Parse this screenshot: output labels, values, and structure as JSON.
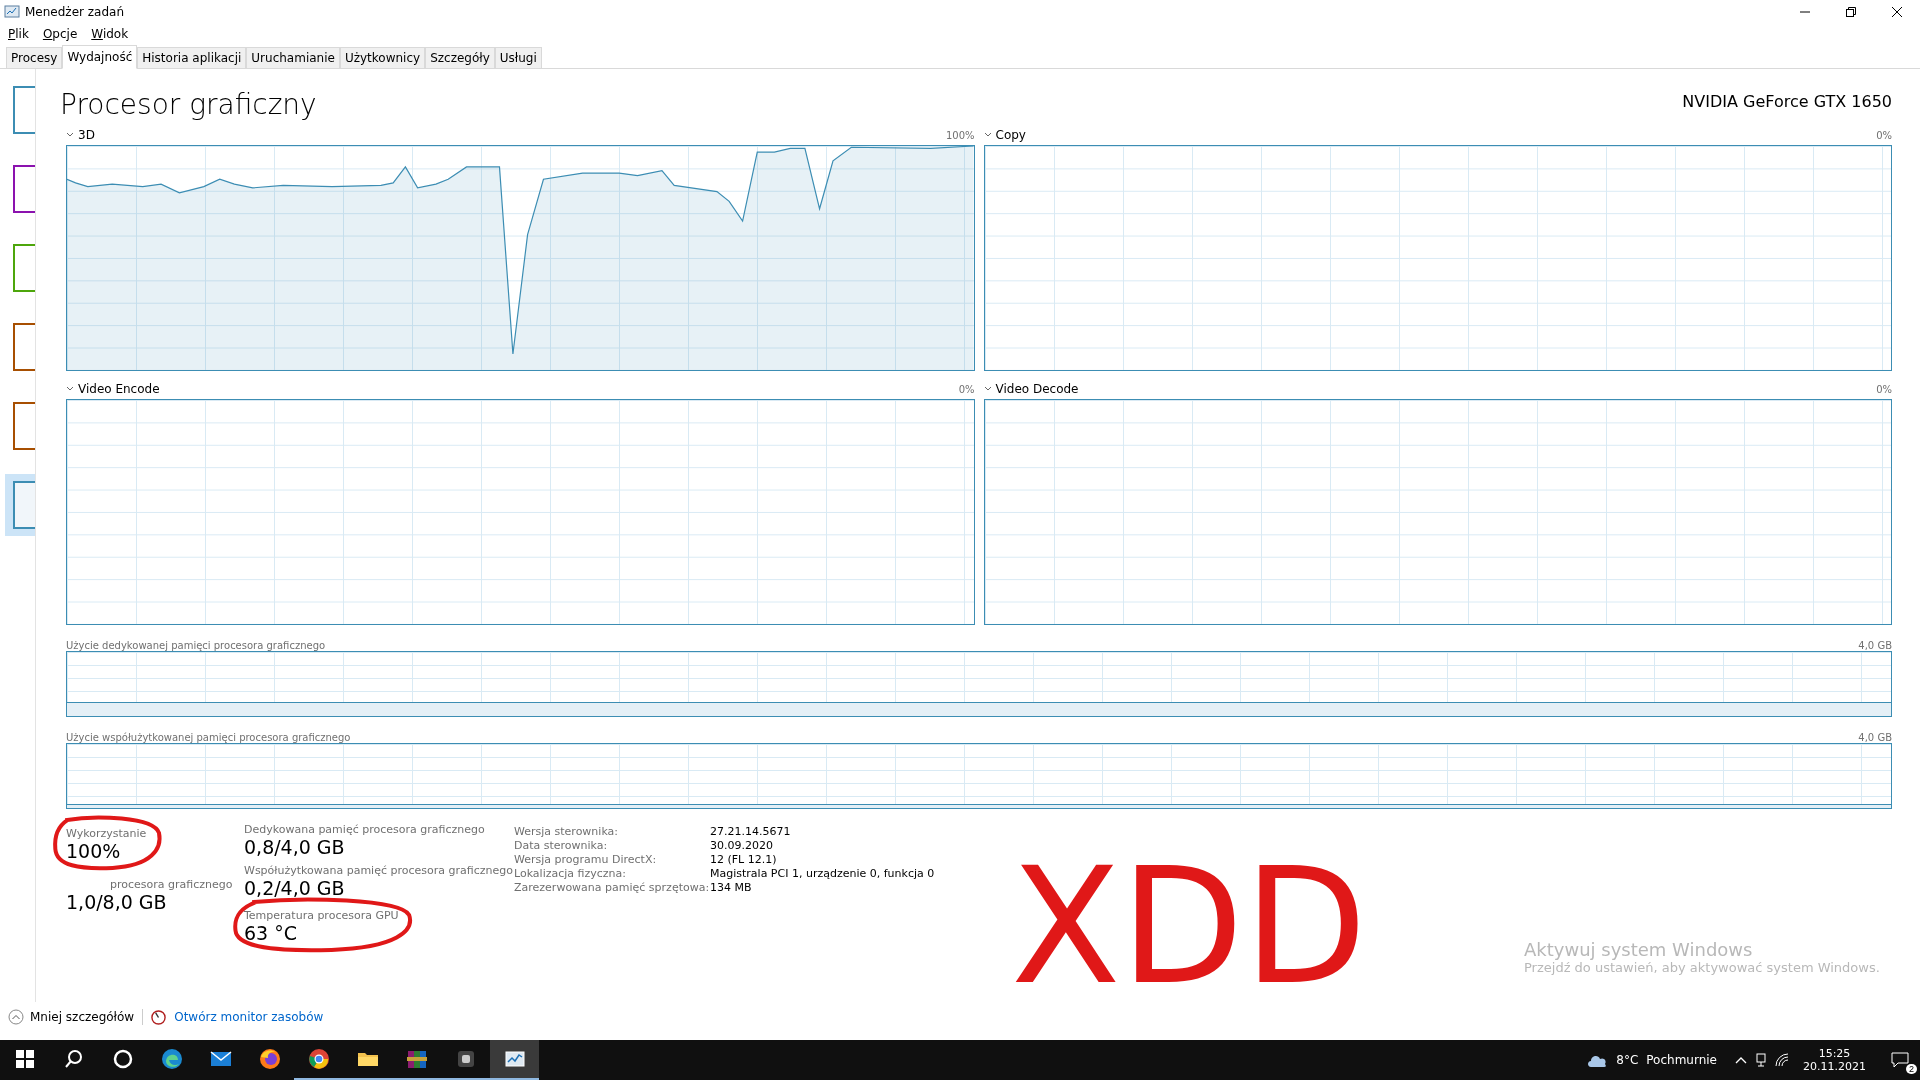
{
  "window": {
    "title": "Menedżer zadań"
  },
  "menu": [
    "Plik",
    "Opcje",
    "Widok"
  ],
  "tabs": [
    {
      "label": "Procesy",
      "selected": false
    },
    {
      "label": "Wydajność",
      "selected": true
    },
    {
      "label": "Historia aplikacji",
      "selected": false
    },
    {
      "label": "Uruchamianie",
      "selected": false
    },
    {
      "label": "Użytkownicy",
      "selected": false
    },
    {
      "label": "Szczegóły",
      "selected": false
    },
    {
      "label": "Usługi",
      "selected": false
    }
  ],
  "sidebar": {
    "items": [
      {
        "color": "#3c8db3",
        "selected": false
      },
      {
        "color": "#8b12ae",
        "selected": false
      },
      {
        "color": "#4da60c",
        "selected": false
      },
      {
        "color": "#a74f01",
        "selected": false
      },
      {
        "color": "#a74f01",
        "selected": false
      },
      {
        "color": "#3c8db3",
        "selected": true
      }
    ]
  },
  "header": {
    "title": "Procesor graficzny",
    "device": "NVIDIA GeForce GTX 1650"
  },
  "engines": [
    {
      "label": "3D",
      "max": "100%",
      "kind": "busy"
    },
    {
      "label": "Copy",
      "max": "0%",
      "kind": "idle"
    },
    {
      "label": "Video Encode",
      "max": "0%",
      "kind": "idle"
    },
    {
      "label": "Video Decode",
      "max": "0%",
      "kind": "idle"
    }
  ],
  "memory_graphs": [
    {
      "label": "Użycie dedykowanej pamięci procesora graficznego",
      "max": "4,0 GB"
    },
    {
      "label": "Użycie współużytkowanej pamięci procesora graficznego",
      "max": "4,0 GB"
    }
  ],
  "stats_columns": [
    [
      {
        "label": "Wykorzystanie",
        "value": "100%",
        "circled": true
      },
      {
        "label": "procesora graficznego",
        "value": "1,0/8,0 GB"
      }
    ],
    [
      {
        "label": "Dedykowana pamięć procesora graficznego",
        "value": "0,8/4,0 GB"
      },
      {
        "label": "Współużytkowana pamięć procesora graficznego",
        "value": "0,2/4,0 GB"
      },
      {
        "label": "Temperatura procesora GPU",
        "value": "63 °C",
        "circled": true
      }
    ]
  ],
  "details": [
    {
      "label": "Wersja sterownika:",
      "value": "27.21.14.5671"
    },
    {
      "label": "Data sterownika:",
      "value": "30.09.2020"
    },
    {
      "label": "Wersja programu DirectX:",
      "value": "12 (FL 12.1)"
    },
    {
      "label": "Lokalizacja fizyczna:",
      "value": "Magistrala PCI 1, urządzenie 0, funkcja 0"
    },
    {
      "label": "Zarezerwowana pamięć sprzętowa:",
      "value": "134 MB"
    }
  ],
  "annotation": {
    "text": "XDD"
  },
  "activation": {
    "title": "Aktywuj system Windows",
    "subtitle": "Przejdź do ustawień, aby aktywować system Windows."
  },
  "footer": {
    "less_details": "Mniej szczegółów",
    "resource_monitor": "Otwórz monitor zasobów"
  },
  "taskbar": {
    "apps": [
      {
        "kind": "start",
        "running": false,
        "selected": false
      },
      {
        "kind": "search",
        "running": false,
        "selected": false
      },
      {
        "kind": "cortana",
        "running": false,
        "selected": false
      },
      {
        "kind": "edge",
        "running": false,
        "selected": false
      },
      {
        "kind": "mail",
        "running": false,
        "selected": false
      },
      {
        "kind": "firefox",
        "running": false,
        "selected": false
      },
      {
        "kind": "chrome",
        "running": true,
        "selected": false
      },
      {
        "kind": "folder",
        "running": true,
        "selected": false
      },
      {
        "kind": "archive",
        "running": true,
        "selected": false
      },
      {
        "kind": "app",
        "running": true,
        "selected": false
      },
      {
        "kind": "monitor",
        "running": true,
        "selected": true
      }
    ],
    "temperature": "8°C",
    "weather": "Pochmurnie",
    "time": "15:25",
    "date": "20.11.2021",
    "notifications": "2"
  }
}
